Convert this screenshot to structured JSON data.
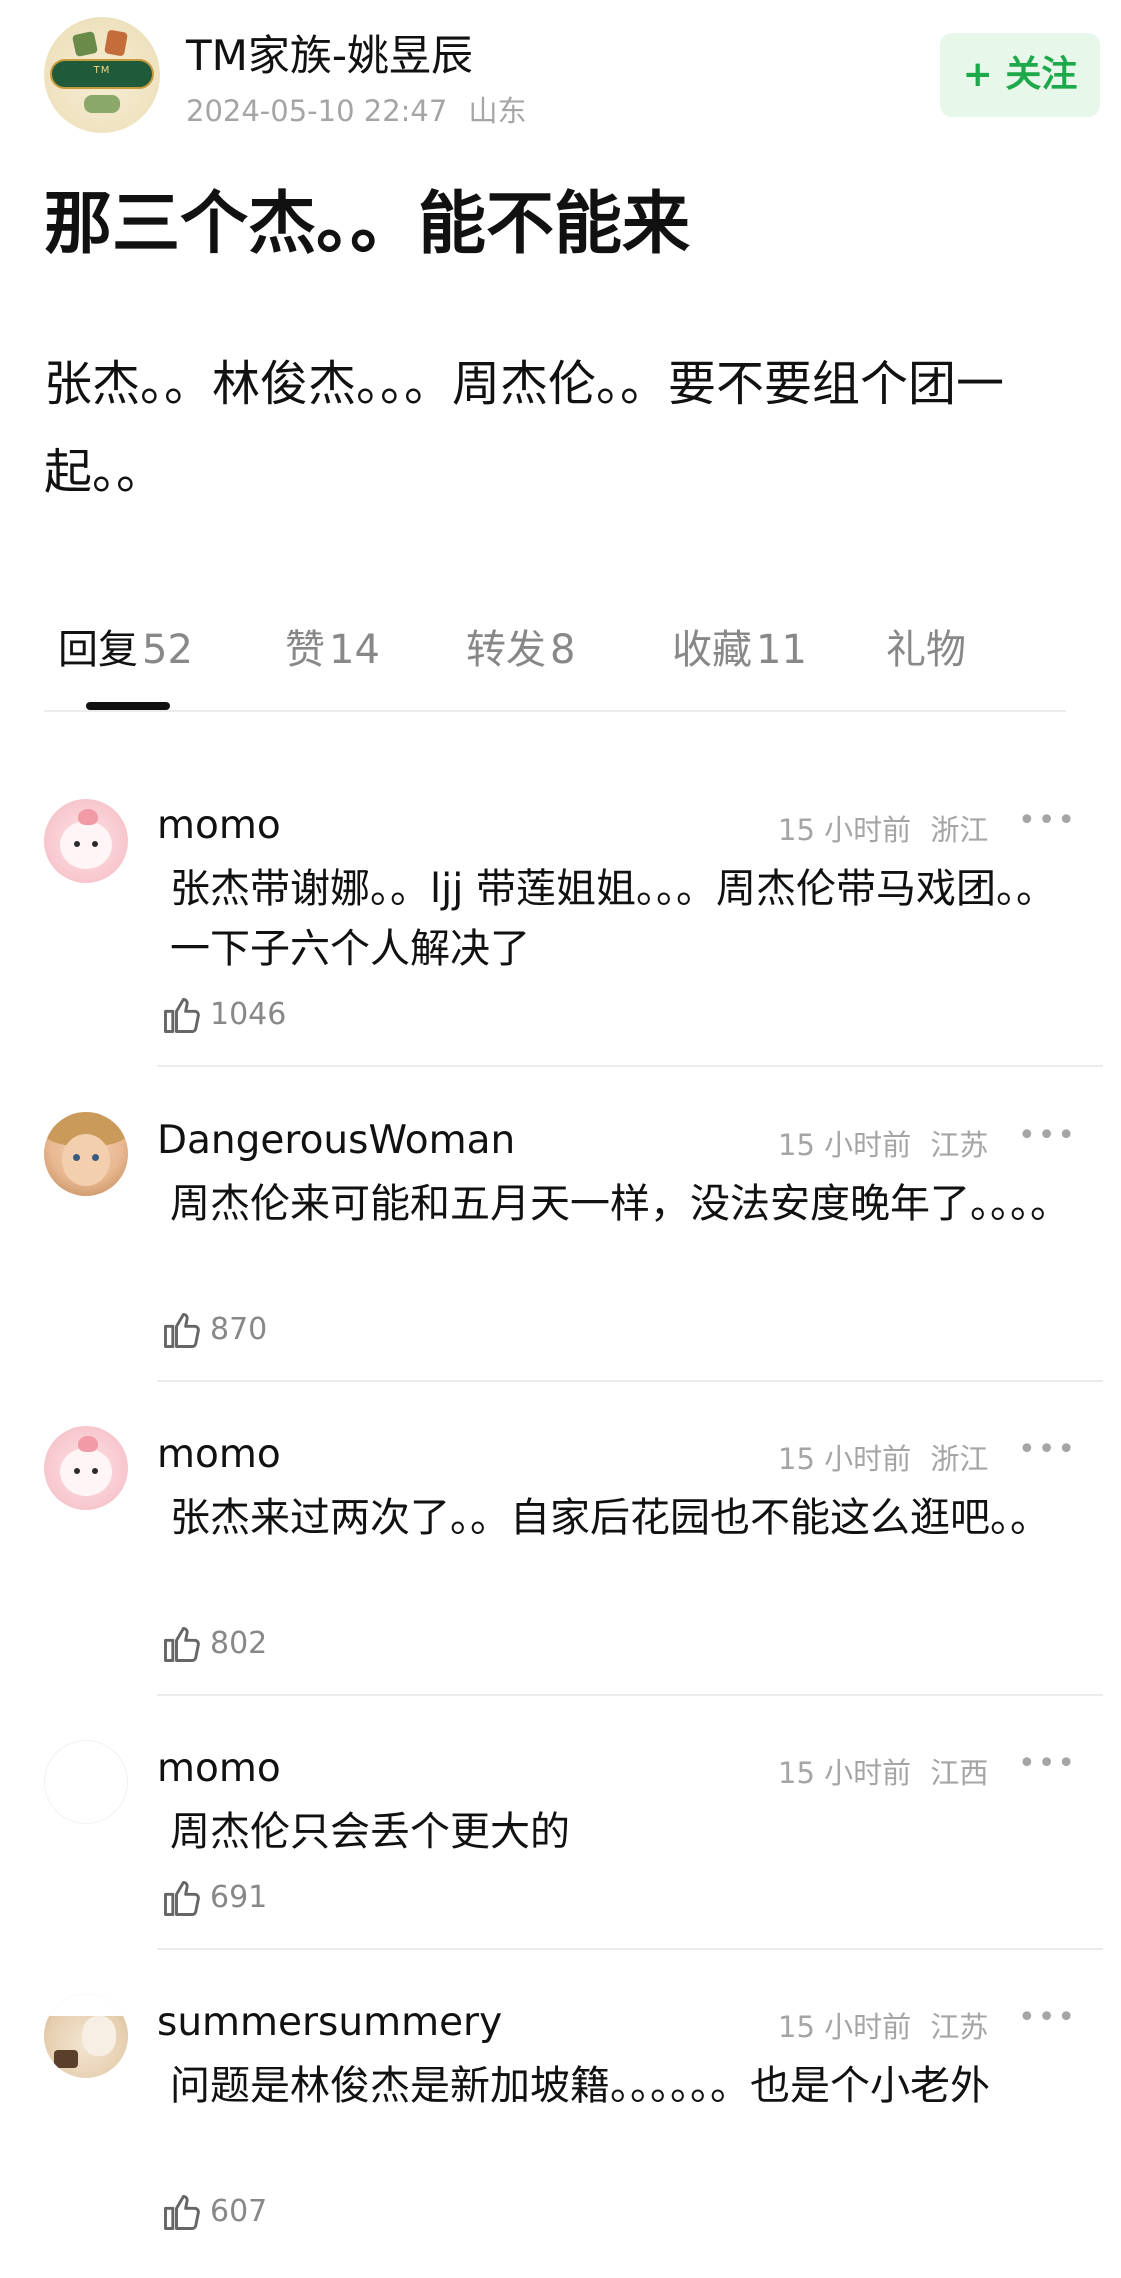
{
  "post": {
    "author": "TM家族-姚昱辰",
    "timestamp": "2024-05-10 22:47",
    "location": "山东",
    "follow_label": "+ 关注",
    "title": "那三个杰。。能不能来",
    "body": "张杰。。林俊杰。。。周杰伦。。要不要组个团一起。。"
  },
  "tabs": [
    {
      "label": "回复",
      "count": "52",
      "active": true
    },
    {
      "label": "赞",
      "count": "14",
      "active": false
    },
    {
      "label": "转发",
      "count": "8",
      "active": false
    },
    {
      "label": "收藏",
      "count": "11",
      "active": false
    },
    {
      "label": "礼物",
      "count": "",
      "active": false
    }
  ],
  "comments": [
    {
      "name": "momo",
      "time": "15 小时前",
      "location": "浙江",
      "text": "张杰带谢娜。。ljj 带莲姐姐。。。周杰伦带马戏团。。一下子六个人解决了",
      "likes": "1046",
      "avatar": "pink-blob-avatar"
    },
    {
      "name": "DangerousWoman",
      "time": "15 小时前",
      "location": "江苏",
      "text": "周杰伦来可能和五月天一样，没法安度晚年了。。。。",
      "likes": "870",
      "avatar": "child-photo-avatar"
    },
    {
      "name": "momo",
      "time": "15 小时前",
      "location": "浙江",
      "text": "张杰来过两次了。。自家后花园也不能这么逛吧。。",
      "likes": "802",
      "avatar": "pink-blob-avatar"
    },
    {
      "name": "momo",
      "time": "15 小时前",
      "location": "江西",
      "text": "周杰伦只会丢个更大的",
      "likes": "691",
      "avatar": "blank-avatar"
    },
    {
      "name": "summersummery",
      "time": "15 小时前",
      "location": "江苏",
      "text": "问题是林俊杰是新加坡籍。。。。。。也是个小老外",
      "likes": "607",
      "avatar": "alpaca-avatar"
    }
  ],
  "colors": {
    "accent_green": "#1da84a",
    "follow_bg": "#e7f7ea",
    "meta_gray": "#a5a5a5"
  },
  "icons": {
    "more": "more-dots-icon",
    "like": "thumbs-up-icon"
  }
}
